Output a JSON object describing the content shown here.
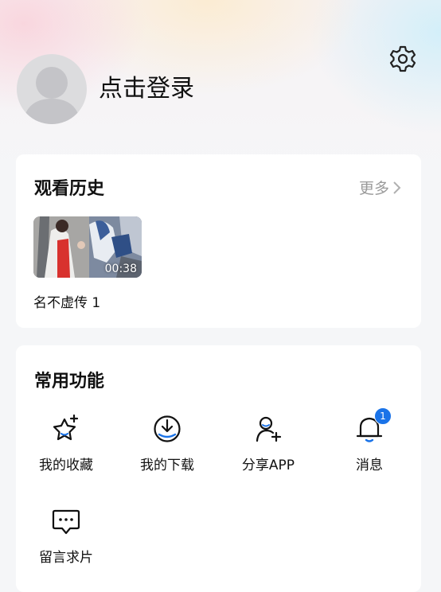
{
  "profile": {
    "login_text": "点击登录"
  },
  "history": {
    "title": "观看历史",
    "more_label": "更多",
    "items": [
      {
        "title": "名不虚传 1",
        "duration": "00:38"
      }
    ]
  },
  "functions": {
    "title": "常用功能",
    "items": [
      {
        "label": "我的收藏",
        "icon": "star-icon"
      },
      {
        "label": "我的下载",
        "icon": "download-icon"
      },
      {
        "label": "分享APP",
        "icon": "add-user-icon"
      },
      {
        "label": "消息",
        "icon": "bell-icon",
        "badge": "1"
      },
      {
        "label": "留言求片",
        "icon": "message-icon"
      }
    ]
  },
  "colors": {
    "accent": "#1a73e8",
    "muted_text": "#9a9a9a",
    "card_bg": "#ffffff",
    "page_bg": "#f5f6f8"
  }
}
